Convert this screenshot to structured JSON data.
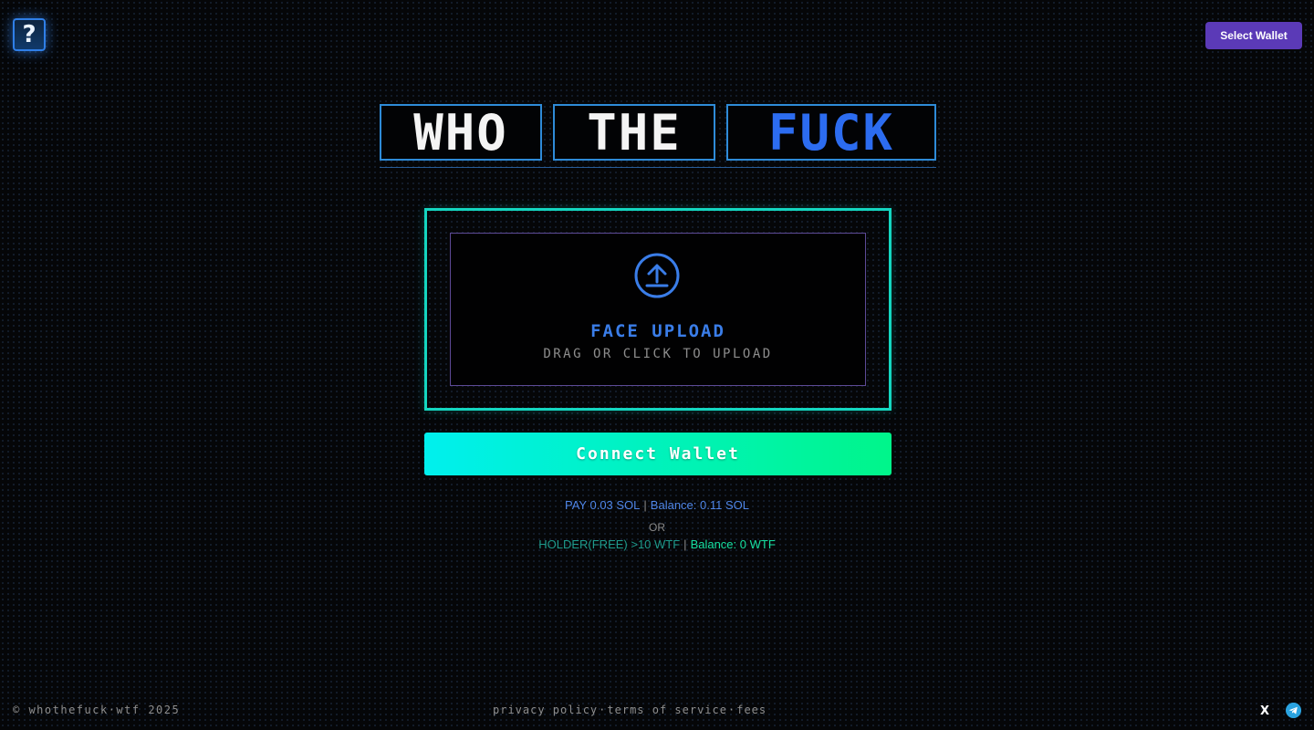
{
  "header": {
    "logo_glyph": "?",
    "select_wallet_label": "Select Wallet"
  },
  "title": {
    "words": [
      "WHO",
      "THE",
      "FUCK"
    ],
    "accent_color": "#2c6cf0"
  },
  "upload": {
    "title": "FACE UPLOAD",
    "subtitle": "DRAG OR CLICK TO UPLOAD",
    "icon": "upload-arrow-icon"
  },
  "actions": {
    "connect_label": "Connect Wallet"
  },
  "payment": {
    "pay_text": "PAY 0.03 SOL",
    "separator": "|",
    "balance_text": "Balance: 0.11 SOL",
    "or_text": "OR",
    "holder_text": "HOLDER(FREE) >10 WTF",
    "holder_balance_text": "Balance: 0 WTF"
  },
  "footer": {
    "copyright": "© whothefuck·wtf 2025",
    "links": [
      "privacy policy",
      "terms of service",
      "fees"
    ],
    "link_separator": "·",
    "social_x": "X",
    "social_x_icon": "x-icon",
    "social_telegram_icon": "telegram-icon"
  },
  "colors": {
    "upload_border": "#14d6c0",
    "inner_border": "#5d4a96",
    "connect_gradient_start": "#00f0ee",
    "connect_gradient_end": "#00f58a",
    "select_wallet_bg": "#5b3ab7"
  }
}
